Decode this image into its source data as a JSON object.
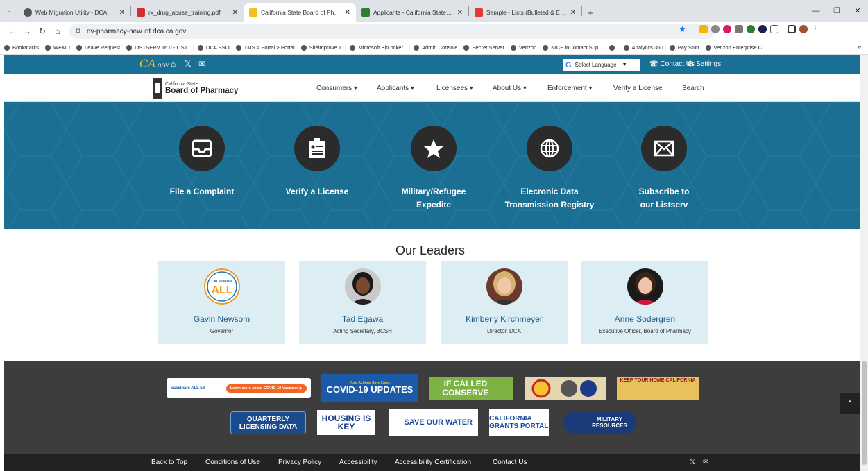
{
  "browser": {
    "tabs": [
      {
        "title": "Web Migration Utility - DCA",
        "favicon_color": "#555555"
      },
      {
        "title": "rx_drug_abuse_training.pdf",
        "favicon_color": "#d32f2f"
      },
      {
        "title": "California State Board of Pharm",
        "favicon_color": "#f0c020"
      },
      {
        "title": "Applicants - California State Bo",
        "favicon_color": "#2e7d32"
      },
      {
        "title": "Sample - Lists (Bulleted & Expa",
        "favicon_color": "#e53935"
      }
    ],
    "new_tab": "+",
    "url": "dv-pharmacy-new.int.dca.ca.gov",
    "bookmarks": [
      "Bookmarks",
      "WEMU",
      "Leave Request",
      "LISTSERV 16.0 - LIST...",
      "DCA SSO",
      "TMS > Portal > Portal",
      "Siteimprove ID",
      "Microsoft BitLocker...",
      "Admin Console",
      "Secret Server",
      "Verizon",
      "NICE inContact Sup...",
      "",
      "Analytics 360",
      "Pay Stub",
      "Verizon Enterprise C..."
    ],
    "bookmarks_more": "»"
  },
  "utility": {
    "logo": "CA",
    "logo_sub": ".GOV",
    "language": "Select Language",
    "contact": "Contact Us",
    "settings": "Settings"
  },
  "header": {
    "brand_sub": "California State",
    "brand_main": "Board of Pharmacy",
    "nav": [
      "Consumers ▾",
      "Applicants ▾",
      "Licensees ▾",
      "About Us ▾",
      "Enforcement ▾",
      "Verify a License",
      "Search"
    ]
  },
  "actions": [
    {
      "line1": "File a Complaint",
      "line2": "",
      "icon": "inbox-icon"
    },
    {
      "line1": "Verify a License",
      "line2": "",
      "icon": "id-card-icon"
    },
    {
      "line1": "Military/Refugee",
      "line2": "Expedite",
      "icon": "star-icon"
    },
    {
      "line1": "Elecronic Data",
      "line2": "Transmission Registry",
      "icon": "globe-icon"
    },
    {
      "line1": "Subscribe to",
      "line2": "our Listserv",
      "icon": "envelope-icon"
    }
  ],
  "leaders_title": "Our Leaders",
  "leaders": [
    {
      "name": "Gavin Newsom",
      "role": "Governor"
    },
    {
      "name": "Tad Egawa",
      "role": "Acting Secretary, BCSH"
    },
    {
      "name": "Kimberly Kirchmeyer",
      "role": "Director, DCA"
    },
    {
      "name": "Anne Sodergren",
      "role": "Executive Officer, Board of Pharmacy"
    }
  ],
  "banners": {
    "vaccinate": "Vaccinate ALL 58",
    "vaccinate_cta": "Learn more about COVID-19 Vaccines ▶",
    "covid_top": "Your Actions Save Lives",
    "covid": "COVID-19 UPDATES",
    "conserve": "IF CALLED CONSERVE",
    "keep_home": "KEEP YOUR HOME CALIFORNIA",
    "quarterly": "QUARTERLY LICENSING DATA",
    "housing": "HOUSING IS KEY",
    "save_water": "SAVE OUR WATER",
    "grants": "CALIFORNIA GRANTS PORTAL",
    "military": "MILITARY RESOURCES"
  },
  "footer_links": [
    "Back to Top",
    "Conditions of Use",
    "Privacy Policy",
    "Accessibility",
    "Accessibility Certification",
    "Contact Us"
  ],
  "colors": {
    "utility_bar": "#1a6f95",
    "hero": "#1b6f93",
    "card": "#dcedf4",
    "footer": "#3d3d3d",
    "bottom_bar": "#222222"
  }
}
